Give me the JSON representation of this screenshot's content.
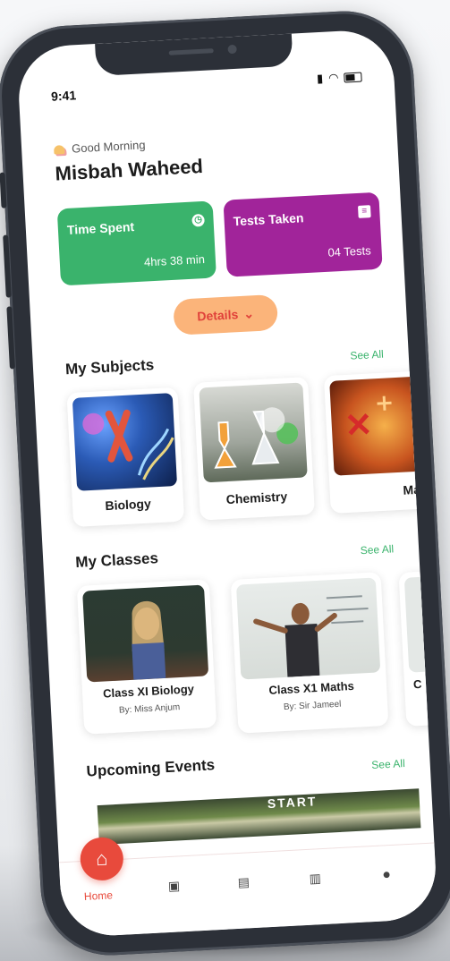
{
  "status_bar": {
    "time": "9:41"
  },
  "header": {
    "greeting": "Good Morning",
    "user_name": "Misbah Waheed"
  },
  "stats": {
    "time_spent": {
      "title": "Time Spent",
      "value": "4hrs 38 min",
      "color": "#3ab36c"
    },
    "tests_taken": {
      "title": "Tests Taken",
      "value": "04 Tests",
      "color": "#a1249a"
    }
  },
  "details_button": {
    "label": "Details",
    "icon": "chevron-down-icon"
  },
  "subjects": {
    "title": "My Subjects",
    "see_all": "See All",
    "items": [
      {
        "label": "Biology"
      },
      {
        "label": "Chemistry"
      },
      {
        "label": "Mat"
      }
    ]
  },
  "classes": {
    "title": "My Classes",
    "see_all": "See All",
    "items": [
      {
        "title": "Class XI Biology",
        "by": "By:  Miss Anjum"
      },
      {
        "title": "Class X1 Maths",
        "by": "By:  Sir Jameel"
      },
      {
        "title": "C",
        "by": ""
      }
    ]
  },
  "events": {
    "title": "Upcoming Events",
    "see_all": "See All",
    "banner_text": "START"
  },
  "bottom_nav": {
    "home_label": "Home",
    "items": [
      "home-icon",
      "classes-icon",
      "tests-icon",
      "reports-icon",
      "profile-icon"
    ]
  },
  "colors": {
    "accent": "#e84a3c",
    "green": "#3ab36c",
    "purple": "#a1249a",
    "orange": "#fbb47a"
  }
}
